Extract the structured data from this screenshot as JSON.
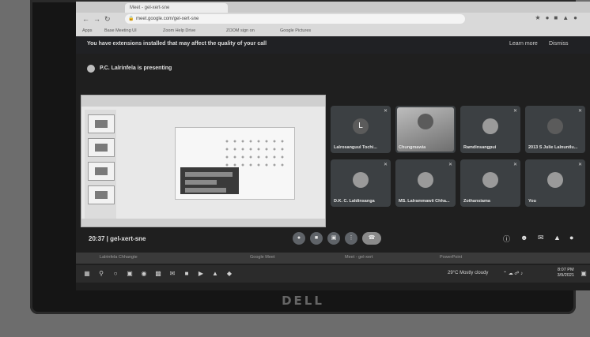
{
  "browser": {
    "tab_title": "Meet - gel-xert-sne",
    "url": "meet.google.com/gel-xert-sne",
    "bookmarks": [
      "Apps",
      "Base Meeting UI",
      "Zoom Help Drive",
      "ZOOM sign on",
      "Google Pictures"
    ]
  },
  "notice": {
    "text": "You have extensions installed that may affect the quality of your call",
    "learn_more": "Learn more",
    "dismiss": "Dismiss"
  },
  "presenter": {
    "label": "P.C. Lalrinfela is presenting"
  },
  "participants": [
    {
      "name": "Lalrosanguul Tochi...",
      "letter": "L",
      "kind": "letter"
    },
    {
      "name": "Chungmawia",
      "letter": "",
      "kind": "camera"
    },
    {
      "name": "Ramdinsangpui",
      "letter": "",
      "kind": "avatar"
    },
    {
      "name": "2013 S Julie Lalnuntlu...",
      "letter": "",
      "kind": "avatar"
    },
    {
      "name": "D.K. C. Laldinsanga",
      "letter": "",
      "kind": "avatar"
    },
    {
      "name": "MS. Lalrammawii Chha...",
      "letter": "",
      "kind": "avatar"
    },
    {
      "name": "Zothansiama",
      "letter": "",
      "kind": "avatar"
    },
    {
      "name": "You",
      "letter": "",
      "kind": "avatar"
    }
  ],
  "bottom_bar": {
    "meeting_code": "20:37 | gel-xert-sne",
    "controls": [
      "mic",
      "camera",
      "present",
      "more",
      "end-call"
    ],
    "side_controls": [
      "info",
      "people",
      "chat",
      "activities",
      "lock"
    ]
  },
  "taskbar": {
    "ghost_items": [
      "Lalrinfela Chhangte",
      "Google Meet",
      "Meet - gel-xert",
      "PowerPoint"
    ],
    "weather": "29°C Mostly cloudy",
    "time": "8:07 PM",
    "date": "3/9/2021"
  },
  "monitor": {
    "brand": "DELL"
  }
}
